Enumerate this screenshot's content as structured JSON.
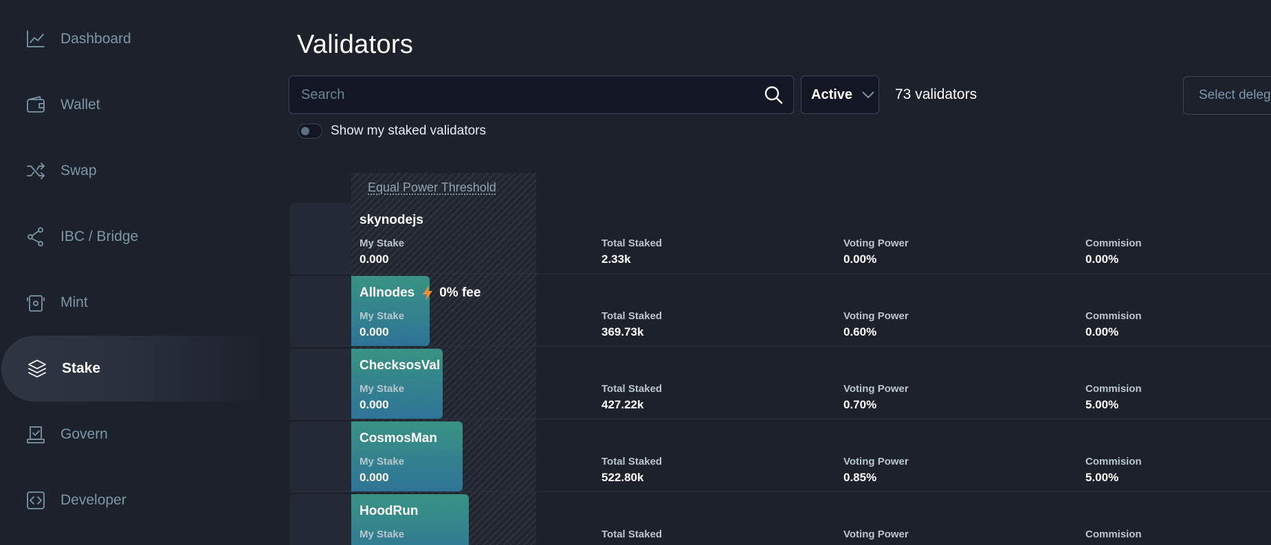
{
  "sidebar": {
    "items": [
      {
        "label": "Dashboard",
        "icon": "chart-line-icon"
      },
      {
        "label": "Wallet",
        "icon": "wallet-icon"
      },
      {
        "label": "Swap",
        "icon": "shuffle-icon"
      },
      {
        "label": "IBC / Bridge",
        "icon": "share-nodes-icon"
      },
      {
        "label": "Mint",
        "icon": "mint-icon"
      },
      {
        "label": "Stake",
        "icon": "layers-icon",
        "active": true
      },
      {
        "label": "Govern",
        "icon": "ballot-icon"
      },
      {
        "label": "Developer",
        "icon": "code-icon"
      }
    ]
  },
  "main": {
    "title": "Validators",
    "search": {
      "placeholder": "Search",
      "value": ""
    },
    "status_filter": {
      "selected": "Active"
    },
    "validator_count": "73 validators",
    "select_delegate_label": "Select deleg",
    "show_staked_toggle": {
      "label": "Show my staked validators",
      "on": false
    },
    "threshold_label": "Equal Power Threshold",
    "stat_labels": {
      "my_stake": "My Stake",
      "total_staked": "Total Staked",
      "voting_power": "Voting Power",
      "commission": "Commision"
    },
    "validators": [
      {
        "name": "skynodejs",
        "fee_badge": "",
        "my_stake": "0.000",
        "total_staked": "2.33k",
        "voting_power": "0.00%",
        "commission": "0.00%",
        "bar_fill": 0
      },
      {
        "name": "Allnodes",
        "fee_badge": "0% fee",
        "my_stake": "0.000",
        "total_staked": "369.73k",
        "voting_power": "0.60%",
        "commission": "0.00%",
        "bar_fill": 0.6
      },
      {
        "name": "ChecksosVal",
        "fee_badge": "",
        "my_stake": "0.000",
        "total_staked": "427.22k",
        "voting_power": "0.70%",
        "commission": "5.00%",
        "bar_fill": 0.7
      },
      {
        "name": "CosmosMan",
        "fee_badge": "",
        "my_stake": "0.000",
        "total_staked": "522.80k",
        "voting_power": "0.85%",
        "commission": "5.00%",
        "bar_fill": 0.85
      },
      {
        "name": "HoodRun",
        "fee_badge": "",
        "my_stake": "",
        "total_staked": "",
        "voting_power": "",
        "commission": "",
        "bar_fill": 0.9
      }
    ]
  },
  "colors": {
    "background": "#1d212c",
    "accent_teal": "#3a9c8a",
    "accent_blue": "#2f7aa0",
    "bolt": "#f08a3c",
    "muted_text": "#7c97a6"
  }
}
